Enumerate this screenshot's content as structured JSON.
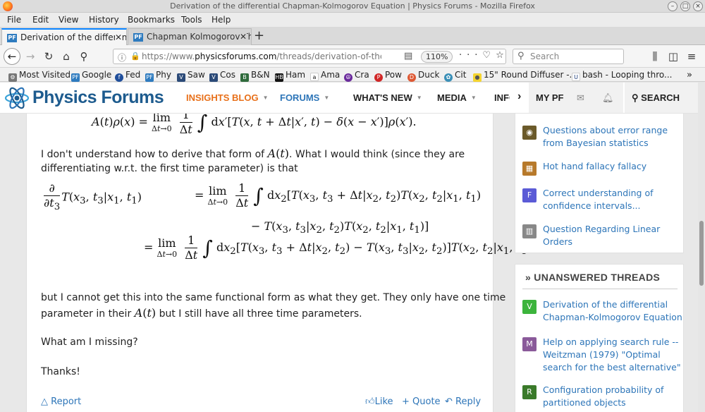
{
  "window": {
    "title": "Derivation of the differential Chapman-Kolmogorov Equation | Physics Forums - Mozilla Firefox"
  },
  "menu": [
    "File",
    "Edit",
    "View",
    "History",
    "Bookmarks",
    "Tools",
    "Help"
  ],
  "tabs": [
    {
      "label": "Derivation of the differen"
    },
    {
      "label": "Chapman Kolmogorov Th"
    }
  ],
  "nav": {
    "url_prefix": "https://www.",
    "url_domain": "physicsforums.com",
    "url_path": "/threads/derivation-of-the-differenti",
    "zoom": "110%",
    "search_placeholder": "Search"
  },
  "bookmarks": [
    {
      "label": "Most Visited",
      "icon": "gear-icon"
    },
    {
      "label": "Google",
      "icon": "pf-icon"
    },
    {
      "label": "Fed",
      "icon": "fed-icon"
    },
    {
      "label": "Phy",
      "icon": "pf-icon"
    },
    {
      "label": "Saw",
      "icon": "saw-icon"
    },
    {
      "label": "Cos",
      "icon": "cos-icon"
    },
    {
      "label": "B&N",
      "icon": "bn-icon"
    },
    {
      "label": "Ham",
      "icon": "hb-icon"
    },
    {
      "label": "Ama",
      "icon": "amazon-icon"
    },
    {
      "label": "Cra",
      "icon": "peace-icon"
    },
    {
      "label": "Pow",
      "icon": "pow-icon"
    },
    {
      "label": "Duck",
      "icon": "duck-icon"
    },
    {
      "label": "Cit",
      "icon": "cit-icon"
    },
    {
      "label": "15\" Round Diffuser -...",
      "icon": "bulb-icon"
    },
    {
      "label": "bash - Looping thro...",
      "icon": "uc-icon"
    }
  ],
  "site": {
    "logo": "Physics Forums",
    "nav": {
      "insights": "INSIGHTS BLOG",
      "forums": "FORUMS",
      "whats_new": "WHAT'S NEW",
      "media": "MEDIA",
      "info": "INFO",
      "my_pf": "MY PF",
      "search": "SEARCH"
    }
  },
  "post": {
    "p1": "I don't understand how to derive that form of",
    "p1_end": ". What I would think (since they are",
    "p2": "differentiating w.r.t. the first time parameter) is that",
    "p3": "but I cannot get this into the same functional form as what they get. They only have one time",
    "p4_start": "parameter in their",
    "p4_mid": "but I still have all three time parameters.",
    "p5": "What am I missing?",
    "p6": "Thanks!",
    "report": "Report",
    "like": "Like",
    "quote": "+ Quote",
    "reply": "Reply"
  },
  "sidebar": {
    "similar": [
      {
        "title": "Questions about error range from Bayesian statistics"
      },
      {
        "title": "Hot hand fallacy fallacy"
      },
      {
        "title": "Correct understanding of confidence intervals...",
        "letter": "F"
      },
      {
        "title": "Question Regarding Linear Orders"
      }
    ],
    "unanswered_heading": "UNANSWERED THREADS",
    "unanswered": [
      {
        "title": "Derivation of the differential Chapman-Kolmogorov Equation",
        "letter": "V"
      },
      {
        "title": "Help on applying search rule -- Weitzman (1979) \"Optimal search for the best alternative\"",
        "letter": "M"
      },
      {
        "title": "Configuration probability of partitioned objects",
        "letter": "R"
      }
    ]
  },
  "colors": {
    "accent_blue": "#2d75b8",
    "insights_orange": "#e8701a",
    "firefox_tab_blue": "#0a84ff"
  }
}
